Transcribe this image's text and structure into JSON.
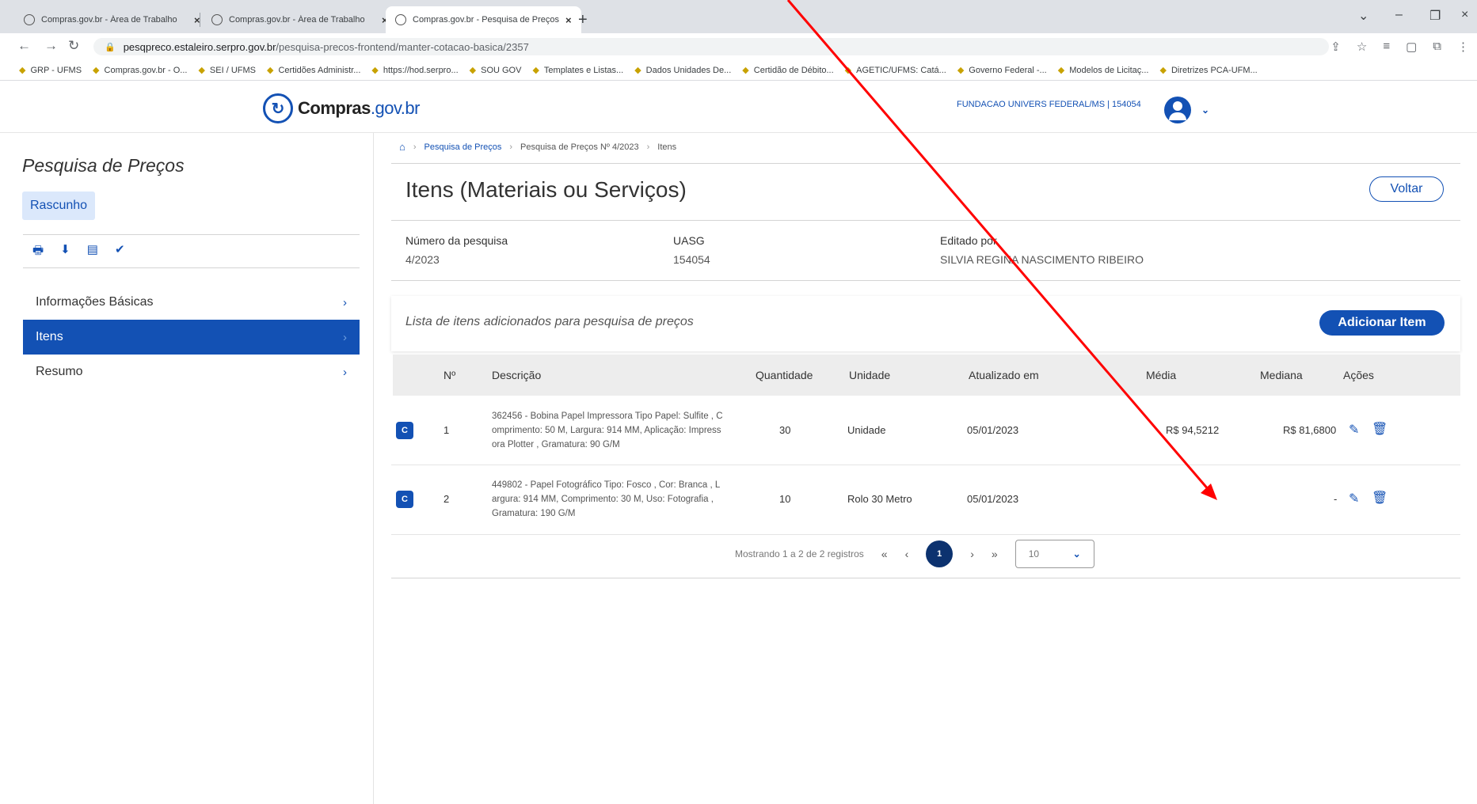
{
  "browser": {
    "tabs": [
      {
        "title": "Compras.gov.br - Área de Trabalho"
      },
      {
        "title": "Compras.gov.br - Área de Trabalho"
      },
      {
        "title": "Compras.gov.br - Pesquisa de Preços"
      }
    ],
    "new_tab": "+",
    "url_domain": "pesqpreco.estaleiro.serpro.gov.br",
    "url_path": "/pesquisa-precos-frontend/manter-cotacao-basica/2357",
    "bookmarks": [
      "GRP - UFMS",
      "Compras.gov.br - O...",
      "SEI / UFMS",
      "Certidões Administr...",
      "https://hod.serpro...",
      "SOU GOV",
      "Templates e Listas...",
      "Dados Unidades De...",
      "Certidão de Débito...",
      "AGETIC/UFMS: Catá...",
      "Governo Federal -...",
      "Modelos de Licitaç...",
      "Diretrizes PCA-UFM..."
    ]
  },
  "header": {
    "brand_main": "Compras",
    "brand_suffix": ".gov.br",
    "org": "FUNDACAO UNIVERS FEDERAL/MS | 154054"
  },
  "sidebar": {
    "title": "Pesquisa de Preços",
    "status": "Rascunho",
    "items": [
      {
        "label": "Informações Básicas"
      },
      {
        "label": "Itens"
      },
      {
        "label": "Resumo"
      }
    ]
  },
  "breadcrumb": {
    "items": [
      "Pesquisa de Preços",
      "Pesquisa de Preços Nº 4/2023",
      "Itens"
    ]
  },
  "main": {
    "title": "Itens (Materiais ou Serviços)",
    "back_label": "Voltar",
    "meta": [
      {
        "label": "Número da pesquisa",
        "value": "4/2023"
      },
      {
        "label": "UASG",
        "value": "154054"
      },
      {
        "label": "Editado por",
        "value": "SILVIA REGINA NASCIMENTO RIBEIRO"
      }
    ],
    "list_label": "Lista de itens adicionados para pesquisa de preços",
    "add_label": "Adicionar Item"
  },
  "table": {
    "headers": [
      "Nº",
      "Descrição",
      "Quantidade",
      "Unidade",
      "Atualizado em",
      "Média",
      "Mediana",
      "Ações"
    ],
    "rows": [
      {
        "type": "C",
        "n": "1",
        "desc": "362456 - Bobina Papel Impressora Tipo Papel: Sulfite , Comprimento: 50 M, Largura: 914 MM, Aplicação: Impressora Plotter , Gramatura: 90 G/M",
        "qty": "30",
        "unit": "Unidade",
        "updated": "05/01/2023",
        "mean": "R$ 94,5212",
        "median": "R$ 81,6800"
      },
      {
        "type": "C",
        "n": "2",
        "desc": "449802 - Papel Fotográfico Tipo: Fosco , Cor: Branca , Largura: 914 MM, Comprimento: 30 M, Uso: Fotografia , Gramatura: 190 G/M",
        "qty": "10",
        "unit": "Rolo 30 Metro",
        "updated": "05/01/2023",
        "mean": "",
        "median": "-"
      }
    ]
  },
  "pagination": {
    "summary": "Mostrando 1 a 2 de 2 registros",
    "first": "«",
    "prev": "‹",
    "current": "1",
    "next": "›",
    "last": "»",
    "page_size": "10"
  },
  "colors": {
    "primary": "#1351b4",
    "annotation": "#ff0000"
  }
}
